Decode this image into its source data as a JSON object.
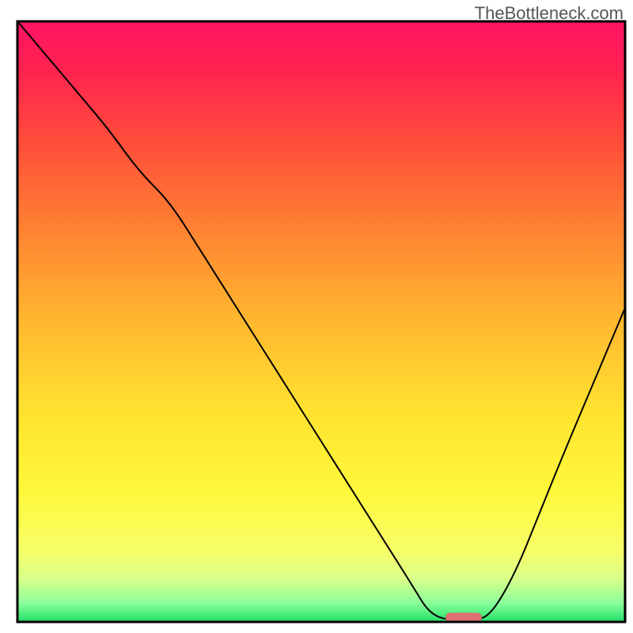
{
  "watermark": "TheBottleneck.com",
  "chart_data": {
    "type": "line",
    "title": "",
    "xlabel": "",
    "ylabel": "",
    "xlim": [
      0,
      100
    ],
    "ylim": [
      0,
      100
    ],
    "background": {
      "type": "vertical_gradient",
      "description": "Gradient from magenta/red at top through orange and yellow to green at bottom, representing bottleneck severity",
      "stops": [
        {
          "offset": 0.0,
          "color": "#ff1464"
        },
        {
          "offset": 0.08,
          "color": "#ff2350"
        },
        {
          "offset": 0.2,
          "color": "#ff4d3a"
        },
        {
          "offset": 0.35,
          "color": "#ff8432"
        },
        {
          "offset": 0.5,
          "color": "#ffb82f"
        },
        {
          "offset": 0.65,
          "color": "#ffe22f"
        },
        {
          "offset": 0.78,
          "color": "#fff83a"
        },
        {
          "offset": 0.88,
          "color": "#f7ff66"
        },
        {
          "offset": 0.93,
          "color": "#d8ff8a"
        },
        {
          "offset": 0.97,
          "color": "#8aff9a"
        },
        {
          "offset": 1.0,
          "color": "#27e06a"
        }
      ]
    },
    "series": [
      {
        "name": "bottleneck-curve",
        "color": "#000000",
        "stroke_width": 2,
        "x": [
          0,
          5,
          10,
          15,
          20,
          25,
          30,
          35,
          40,
          45,
          50,
          55,
          60,
          65,
          68,
          72,
          75,
          78,
          82,
          86,
          90,
          95,
          100
        ],
        "y": [
          100,
          94,
          88,
          82,
          75,
          70,
          62,
          54,
          46,
          38,
          30,
          22,
          14,
          6,
          1,
          0,
          0,
          1,
          8,
          18,
          28,
          40,
          52
        ]
      }
    ],
    "marker": {
      "name": "optimal-region",
      "shape": "rounded-rect",
      "color": "#dd6f70",
      "x_center": 73.5,
      "y_center": 0.6,
      "width": 6.0,
      "height": 1.6
    },
    "axes": {
      "frame_color": "#000000",
      "frame_width": 3
    }
  }
}
